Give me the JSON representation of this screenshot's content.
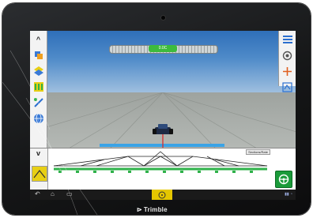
{
  "device": {
    "brand": "Trimble"
  },
  "guidance": {
    "offset_label": "0.0C"
  },
  "left_toolbar": {
    "items": [
      {
        "label": "^",
        "icon": "collapse-up-icon"
      },
      {
        "label": "",
        "icon": "layers-icon"
      },
      {
        "label": "",
        "icon": "field-map-icon"
      },
      {
        "label": "",
        "icon": "coverage-bars-icon"
      },
      {
        "label": "",
        "icon": "guidance-line-icon"
      },
      {
        "label": "",
        "icon": "globe-gps-icon"
      }
    ],
    "expand_label": "v"
  },
  "right_toolbar": {
    "items": [
      {
        "icon": "menu-icon"
      },
      {
        "icon": "view-camera-icon"
      },
      {
        "icon": "nudge-arrows-icon"
      },
      {
        "icon": "zoom-map-icon"
      }
    ]
  },
  "bottom": {
    "boom_label": "Sections/Rate"
  },
  "colors": {
    "coverage": "#e8cf14",
    "guide_line": "#e02020",
    "boom_line": "#3aa3e6",
    "engage": "#1b9b3a",
    "active_section": "#2fb24a"
  },
  "nav": {
    "back_icon": "back-icon",
    "home_icon": "home-icon",
    "recent_icon": "recent-apps-icon",
    "center_icon": "steering-wheel-icon"
  }
}
